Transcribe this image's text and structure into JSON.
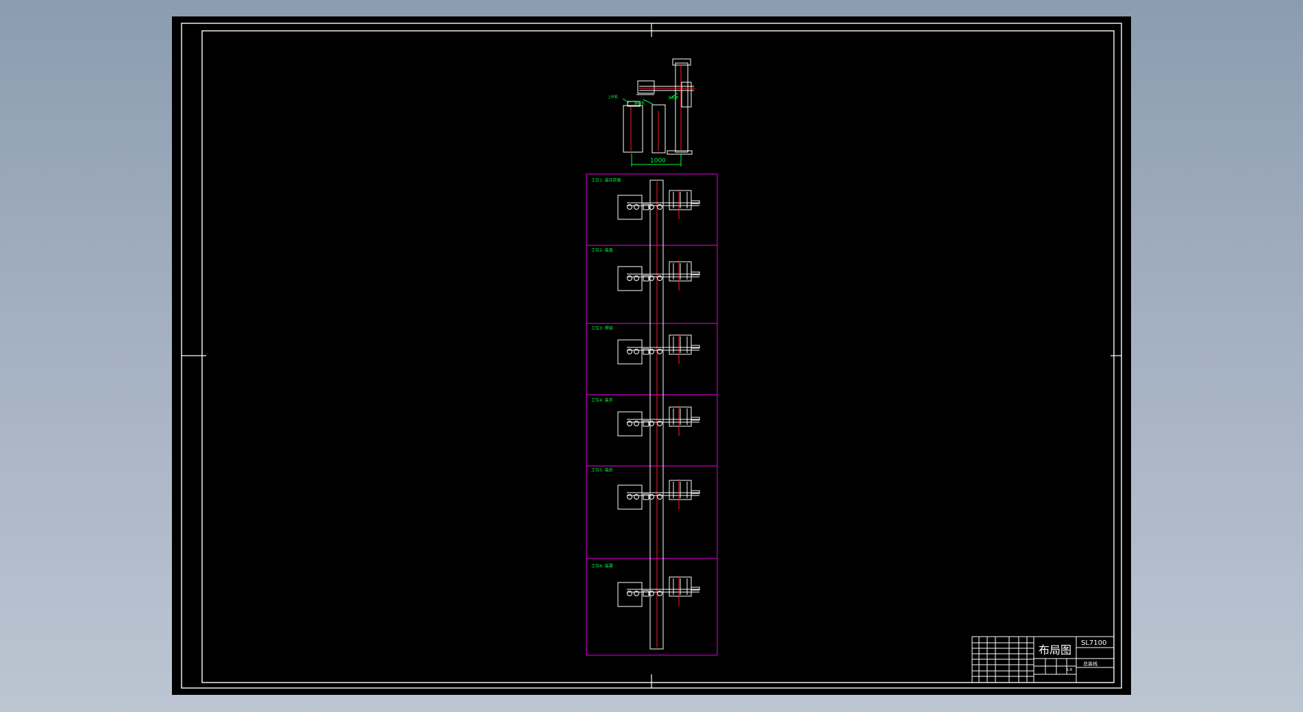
{
  "viewer": {
    "background_top": "#8c9cb0",
    "background_bottom": "#bcc5d2",
    "canvas_color": "#000000"
  },
  "colors": {
    "frame": "#ffffff",
    "cell_border": "#c000c0",
    "centerline": "#ff2020",
    "annotation": "#00ff40"
  },
  "top_view": {
    "dimension": "1000",
    "labels": [
      "上料机",
      "翻转机",
      "主机架"
    ]
  },
  "stations": [
    {
      "label": "工位1: 装压前板"
    },
    {
      "label": "工位2: 装盖"
    },
    {
      "label": "工位3: 焊接"
    },
    {
      "label": "工位4: 装手"
    },
    {
      "label": "工位5: 装后"
    },
    {
      "label": "工位6: 装罩"
    }
  ],
  "title_block": {
    "drawing_title": "布局图",
    "drawing_number": "SL7100",
    "product_name": "总装线",
    "scale": "1:8"
  }
}
